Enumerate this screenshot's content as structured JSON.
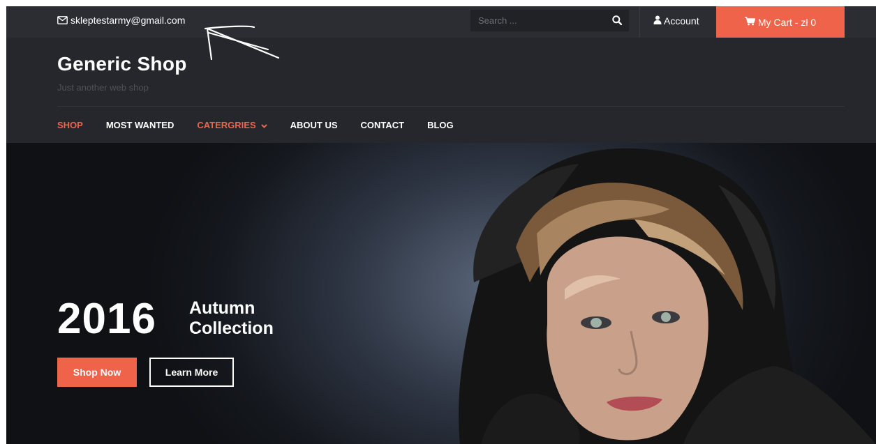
{
  "topbar": {
    "email": "skleptestarmy@gmail.com",
    "search_placeholder": "Search ...",
    "account_label": "Account",
    "cart_label": "My Cart - zł 0"
  },
  "header": {
    "site_title": "Generic Shop",
    "tagline": "Just another web shop"
  },
  "nav": {
    "items": [
      {
        "label": "SHOP",
        "state": "active"
      },
      {
        "label": "MOST WANTED"
      },
      {
        "label": "CATERGRIES",
        "state": "accent",
        "has_dropdown": true
      },
      {
        "label": "ABOUT US"
      },
      {
        "label": "CONTACT"
      },
      {
        "label": "BLOG"
      }
    ]
  },
  "hero": {
    "year": "2016",
    "subtitle_line1": "Autumn",
    "subtitle_line2": "Collection",
    "primary_button": "Shop Now",
    "secondary_button": "Learn More"
  },
  "icons": [
    "envelope-icon",
    "search-icon",
    "user-icon",
    "cart-icon",
    "chevron-down-icon"
  ],
  "colors": {
    "accent": "#f0634b",
    "topbar_bg": "#2b2d33",
    "header_bg": "#25272c",
    "text": "#ffffff"
  }
}
